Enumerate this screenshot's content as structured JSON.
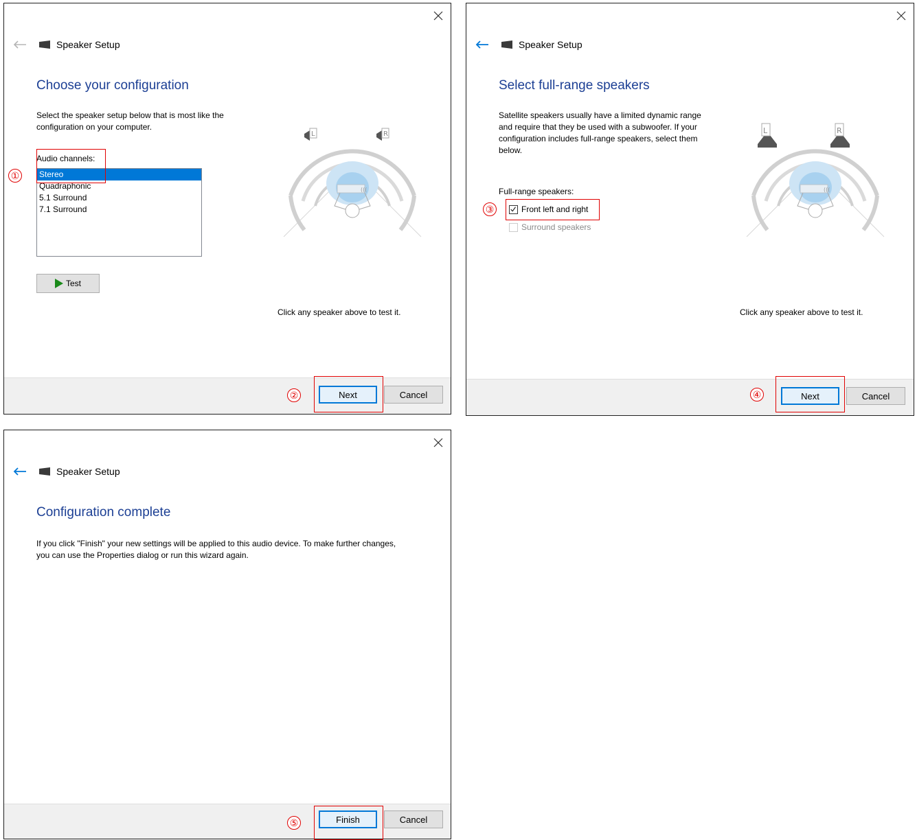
{
  "dialog1": {
    "window_title": "Speaker Setup",
    "heading": "Choose your configuration",
    "description": "Select the speaker setup below that is most like the configuration on your computer.",
    "list_label": "Audio channels:",
    "options": [
      "Stereo",
      "Quadraphonic",
      "5.1 Surround",
      "7.1 Surround"
    ],
    "selected": "Stereo",
    "test_label": "Test",
    "hint": "Click any speaker above to test it.",
    "next_label": "Next",
    "cancel_label": "Cancel",
    "step_a": "①",
    "step_b": "②"
  },
  "dialog2": {
    "window_title": "Speaker Setup",
    "heading": "Select full-range speakers",
    "description": "Satellite speakers usually have a limited dynamic range and require that they be used with a subwoofer. If your configuration includes full-range speakers, select them below.",
    "group_label": "Full-range speakers:",
    "check1_label": "Front left and right",
    "check1_checked": true,
    "check2_label": "Surround speakers",
    "check2_enabled": false,
    "hint": "Click any speaker above to test it.",
    "next_label": "Next",
    "cancel_label": "Cancel",
    "step_a": "③",
    "step_b": "④"
  },
  "dialog3": {
    "window_title": "Speaker Setup",
    "heading": "Configuration complete",
    "description": "If you click \"Finish\" your new settings will be applied to this audio device.  To make further changes, you can use the Properties dialog or run this wizard again.",
    "finish_label": "Finish",
    "cancel_label": "Cancel",
    "step_a": "⑤"
  },
  "speaker_labels": {
    "left": "L",
    "right": "R"
  },
  "colors": {
    "accent": "#0078d7",
    "heading": "#1c3f94",
    "annotation": "#e00000",
    "test_play": "#1a8a1a"
  }
}
